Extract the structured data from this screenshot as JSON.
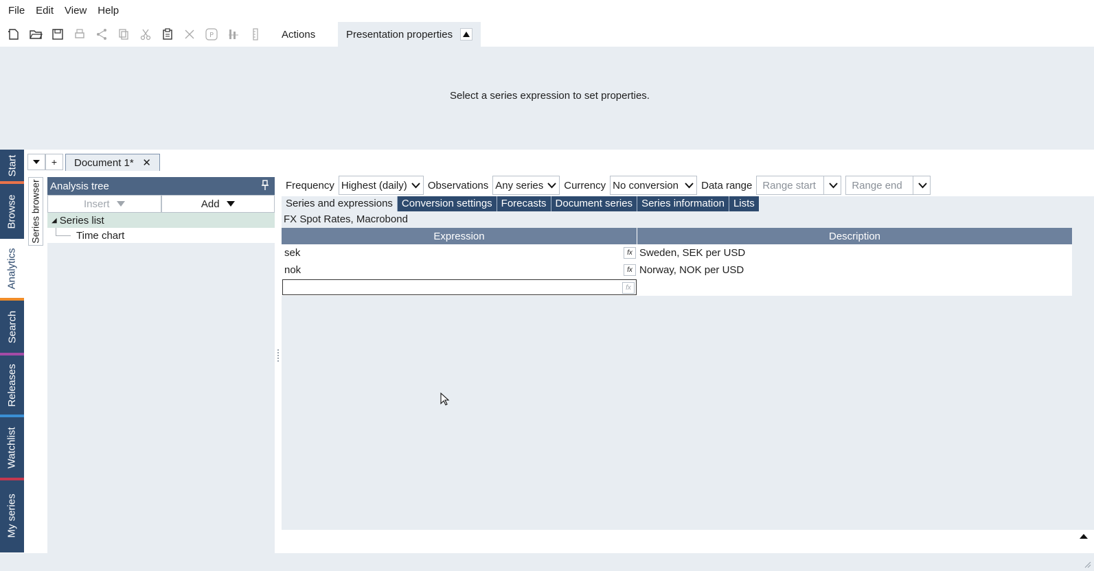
{
  "menu": [
    "File",
    "Edit",
    "View",
    "Help"
  ],
  "toolbar": {
    "icons": [
      "new-document-icon",
      "open-folder-icon",
      "save-icon",
      "print-icon",
      "share-icon",
      "copy-icon",
      "cut-icon",
      "paste-icon",
      "delete-icon",
      "presentation-icon",
      "columns-icon",
      "ruler-icon"
    ],
    "actions_label": "Actions",
    "presentation_label": "Presentation properties"
  },
  "props_panel": {
    "message": "Select a series expression to set properties."
  },
  "side_tabs": [
    {
      "label": "Start",
      "sep_color": "#e8734a"
    },
    {
      "label": "Browse",
      "sep_color": ""
    },
    {
      "label": "Analytics",
      "sep_color": "#f08c28"
    },
    {
      "label": "Search",
      "sep_color": "#a34ba6"
    },
    {
      "label": "Releases",
      "sep_color": "#3a8fd4"
    },
    {
      "label": "Watchlist",
      "sep_color": "#c4384f"
    },
    {
      "label": "My series",
      "sep_color": ""
    }
  ],
  "doc_tab": {
    "label": "Document 1*",
    "add": "+"
  },
  "series_browser": "Series browser",
  "tree": {
    "title": "Analysis tree",
    "insert_label": "Insert",
    "add_label": "Add",
    "items": [
      {
        "label": "Series list",
        "selected": true
      },
      {
        "label": "Time chart",
        "selected": false
      }
    ]
  },
  "filters": {
    "frequency_label": "Frequency",
    "frequency_value": "Highest (daily)",
    "observations_label": "Observations",
    "observations_value": "Any series",
    "currency_label": "Currency",
    "currency_value": "No conversion",
    "range_label": "Data range",
    "range_start": "Range start",
    "range_end": "Range end"
  },
  "subtabs": [
    "Series and expressions",
    "Conversion settings",
    "Forecasts",
    "Document series",
    "Series information",
    "Lists"
  ],
  "list_title": "FX Spot Rates, Macrobond",
  "grid": {
    "headers": [
      "Expression",
      "Description"
    ],
    "rows": [
      {
        "expression": "sek",
        "description": "Sweden, SEK per USD"
      },
      {
        "expression": "nok",
        "description": "Norway, NOK per USD"
      }
    ],
    "fx_label": "fx"
  },
  "colors": {
    "accent": "#2d4a6e",
    "header": "#4d6584",
    "panel": "#e8edf2"
  }
}
